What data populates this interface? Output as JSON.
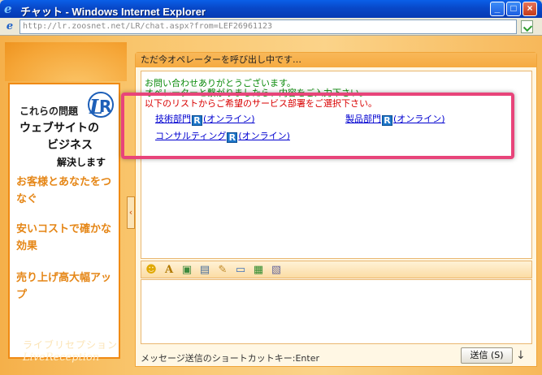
{
  "window": {
    "title": "チャット - Windows Internet Explorer",
    "ie_icon": "ie-logo-icon",
    "minimize": "_",
    "maximize": "□",
    "close": "×"
  },
  "address": {
    "url": "http://lr.zoosnet.net/LR/chat.aspx?from=LEF26961123"
  },
  "left": {
    "promo_line1": "これらの問題",
    "promo_line2": "ウェブサイトの",
    "promo_line3": "ビジネス",
    "promo_line4": "解決します",
    "items": [
      "お客様とあなたをつなぐ",
      "安いコストで確かな効果",
      "売り上げ高大幅アップ"
    ],
    "brand_jp": "ライブリセプション",
    "brand_en": "LiveReception"
  },
  "chat": {
    "status": "ただ今オペレーターを呼び出し中です…",
    "msg1": "お問い合わせありがとうございます。",
    "msg2": "オペレーターと繋がりましたら、内容をご入力下さい。",
    "msg3": "以下のリストからご希望のサービス部署をご選択下さい。",
    "departments": [
      {
        "name": "技術部門",
        "status": "(オンライン)"
      },
      {
        "name": "製品部門",
        "status": "(オンライン)"
      },
      {
        "name": "コンサルティング",
        "status": "(オンライン)"
      }
    ],
    "badge": "R",
    "shortcut_text": "メッセージ送信のショートカットキー:Enter",
    "send_label": "送信 (S)",
    "send_arrow": "↓"
  },
  "colors": {
    "accent_orange": "#f08a14",
    "highlight_pink": "#e8447a",
    "link_blue": "#0000d0",
    "msg_green": "#0a8a0a",
    "msg_red": "#d90000"
  },
  "toolbar_icons": [
    "smiley-icon",
    "font-icon",
    "image-icon",
    "print-icon",
    "note-icon",
    "screen-icon",
    "save-icon",
    "file-icon"
  ]
}
